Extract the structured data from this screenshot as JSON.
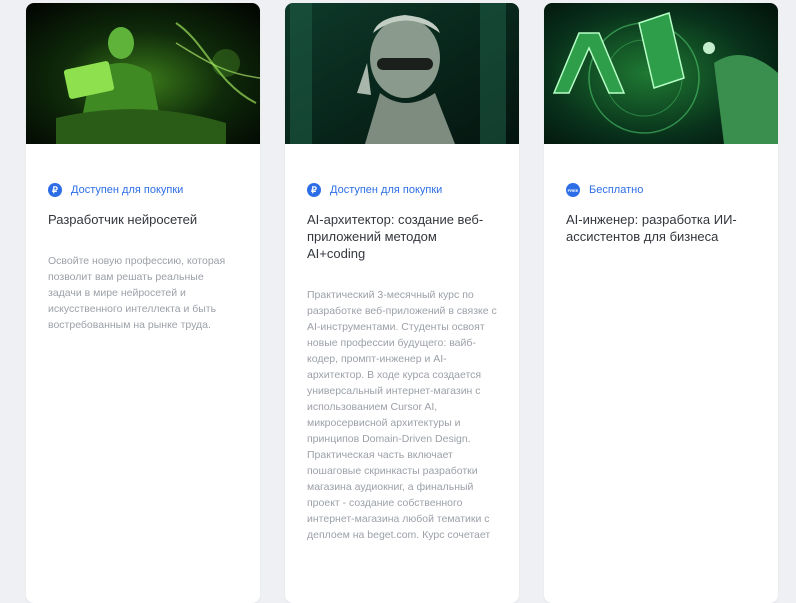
{
  "cards": [
    {
      "image_alt": "green neon statue with laptop and DNA helix",
      "badge_icon": "ruble-icon",
      "badge_icon_char": "₽",
      "badge": "Доступен для покупки",
      "title": "Разработчик нейросетей",
      "description": "Освойте новую профессию, которая позволит вам решать реальные задачи в мире нейросетей и искусственного интеллекта и быть востребованным на рынке труда."
    },
    {
      "image_alt": "cyborg statue with glasses",
      "badge_icon": "ruble-icon",
      "badge_icon_char": "₽",
      "badge": "Доступен для покупки",
      "title": "AI-архитектор: создание веб-приложений методом AI+coding",
      "description": "Практический 3-месячный курс по разработке веб-приложений в связке с AI-инструментами. Студенты освоят новые профессии будущего: вайб-кодер, промпт-инженер и AI-архитектор. В ходе курса создается универсальный интернет-магазин с использованием Cursor AI, микросервисной архитектуры и принципов Domain-Driven Design. Практическая часть включает пошаговые скринкасты разработки магазина аудиокниг, а финальный проект - создание собственного интернет-магазина любой тематики с деплоем на beget.com. Курс сочетает"
    },
    {
      "image_alt": "green AI letters with hand",
      "badge_icon": "free-icon",
      "badge_icon_char": "FREE",
      "badge": "Бесплатно",
      "title": "AI-инженер: разработка ИИ-ассистентов для бизнеса",
      "description": ""
    }
  ]
}
